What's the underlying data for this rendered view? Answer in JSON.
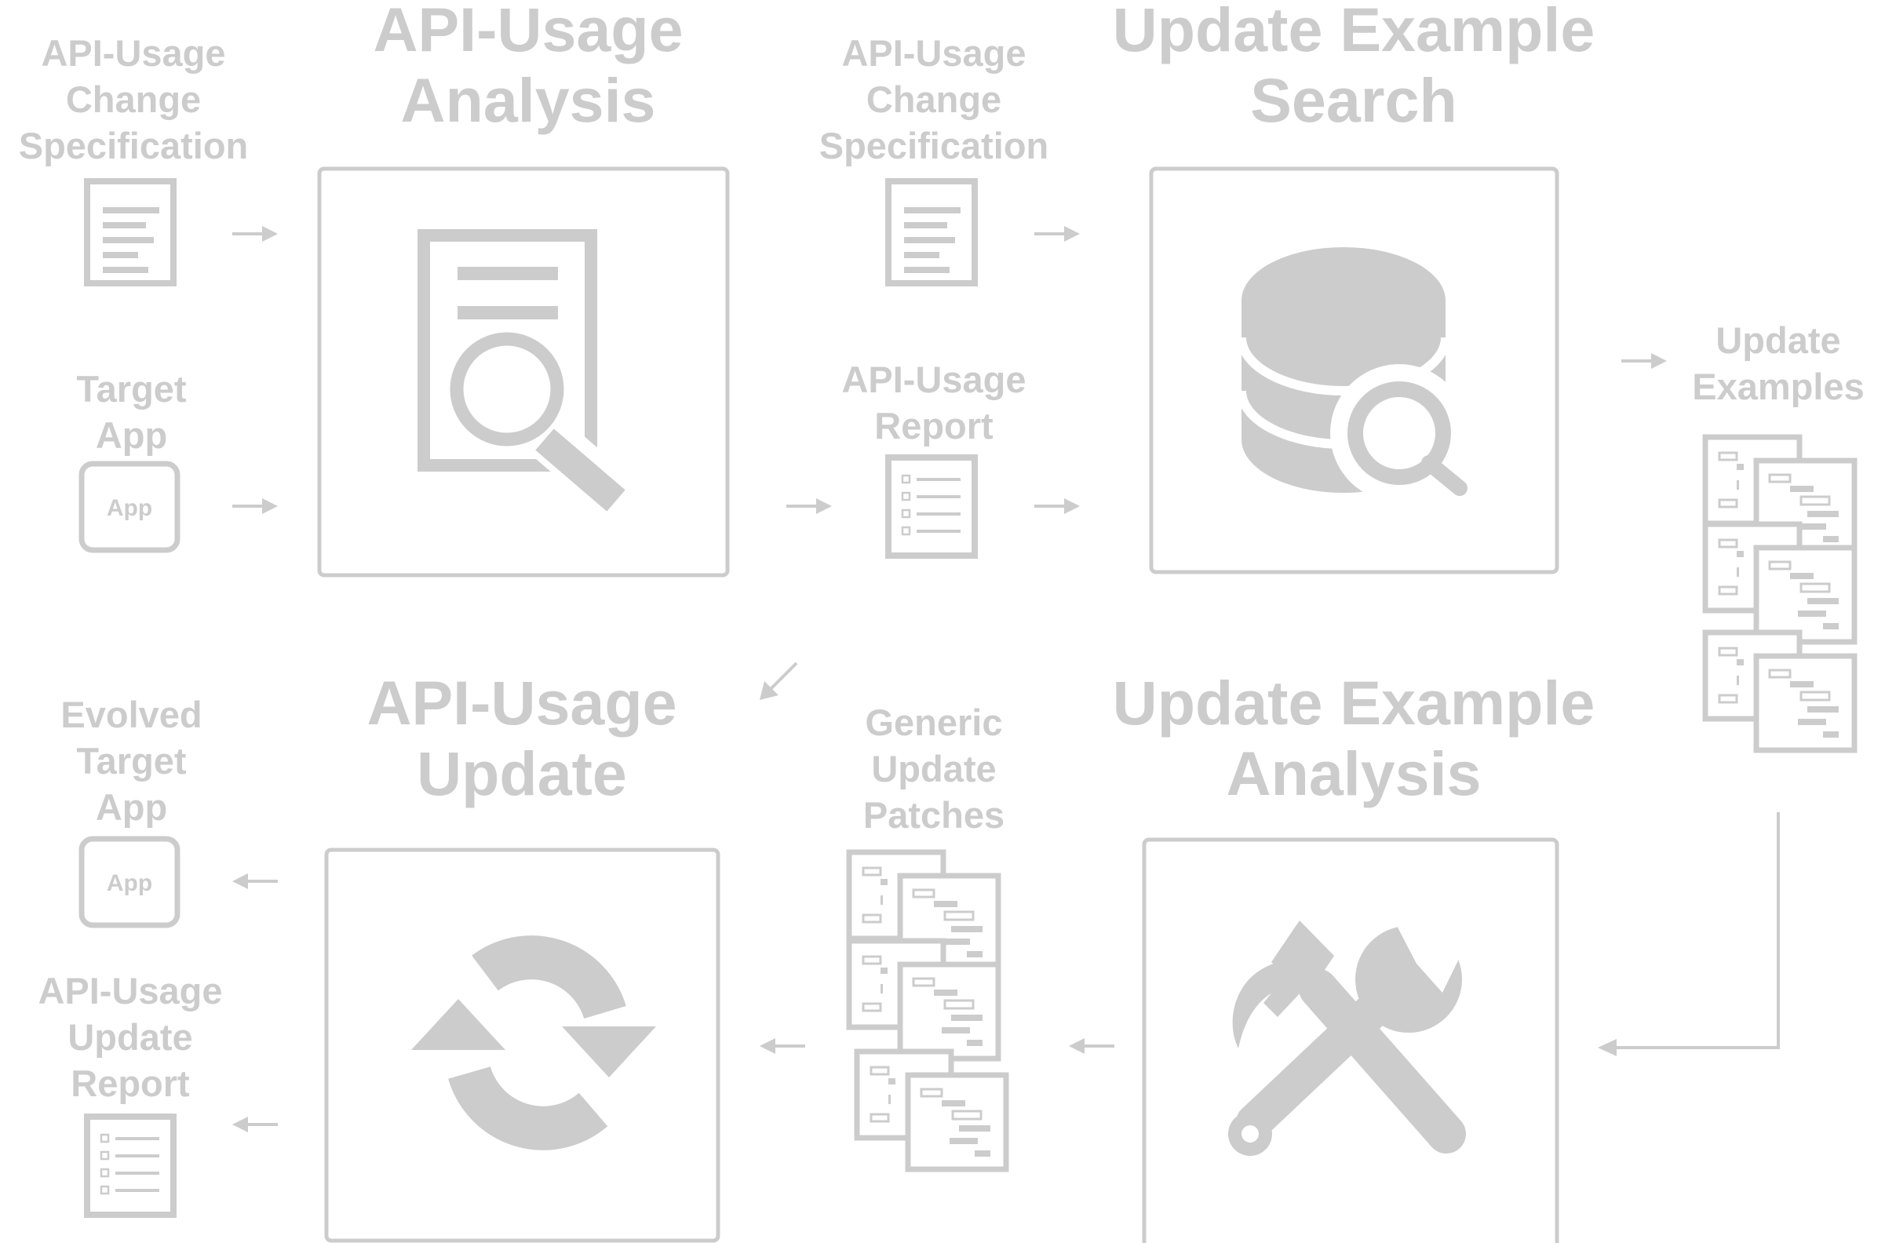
{
  "colors": {
    "fg": "#cccccc",
    "bg": "#ffffff"
  },
  "stages": {
    "analysis": {
      "title": "API-Usage\nAnalysis",
      "icon": "document-search-icon"
    },
    "example_search": {
      "title": "Update Example\nSearch",
      "icon": "database-search-icon"
    },
    "example_analysis": {
      "title": "Update Example\nAnalysis",
      "icon": "hammer-wrench-icon"
    },
    "update": {
      "title": "API-Usage\nUpdate",
      "icon": "refresh-arrows-icon"
    }
  },
  "artifacts": {
    "change_spec_1": {
      "label": "API-Usage\nChange\nSpecification",
      "icon": "document-icon"
    },
    "target_app": {
      "label": "Target\nApp",
      "icon": "app-icon",
      "icon_text": "App"
    },
    "change_spec_2": {
      "label": "API-Usage\nChange\nSpecification",
      "icon": "document-icon"
    },
    "usage_report": {
      "label": "API-Usage\nReport",
      "icon": "checklist-icon"
    },
    "update_examples": {
      "label": "Update\nExamples",
      "icon": "code-pages-icon"
    },
    "generic_patches": {
      "label": "Generic\nUpdate\nPatches",
      "icon": "code-pages-icon"
    },
    "evolved_app": {
      "label": "Evolved\nTarget\nApp",
      "icon": "app-icon",
      "icon_text": "App"
    },
    "update_report": {
      "label": "API-Usage\nUpdate\nReport",
      "icon": "checklist-icon"
    }
  }
}
